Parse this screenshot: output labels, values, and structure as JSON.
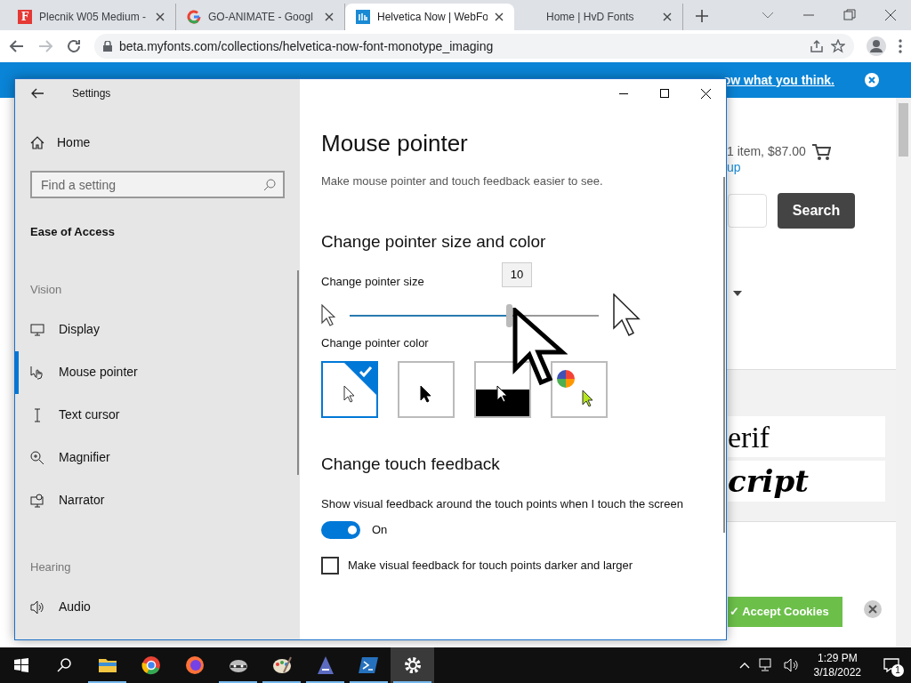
{
  "browser": {
    "tabs": [
      {
        "title": "Plecnik W05 Medium -",
        "kind": "letter",
        "favicon_text": "F",
        "selected": false
      },
      {
        "title": "GO-ANIMATE - Googl",
        "kind": "google",
        "selected": false
      },
      {
        "title": "Helvetica Now | WebFo",
        "kind": "myfonts",
        "selected": true
      },
      {
        "title": "Home | HvD Fonts",
        "kind": "blank",
        "selected": false
      }
    ],
    "address": "beta.myfonts.com/collections/helvetica-now-font-monotype_imaging",
    "banner_link": "ow what you think."
  },
  "webpage": {
    "cart": "1 item, $87.00",
    "link": "up",
    "search_button": "Search",
    "samples": [
      {
        "text": "erif",
        "kind": "serif"
      },
      {
        "text": "cript",
        "kind": "script"
      }
    ],
    "cookies_button": "✓ Accept Cookies"
  },
  "settings": {
    "title": "Settings",
    "home": "Home",
    "search_placeholder": "Find a setting",
    "category": "Ease of Access",
    "groups": [
      {
        "title": "Vision",
        "items": [
          {
            "label": "Display",
            "kind": "display",
            "selected": false
          },
          {
            "label": "Mouse pointer",
            "kind": "pointer",
            "selected": true
          },
          {
            "label": "Text cursor",
            "kind": "cursor",
            "selected": false
          },
          {
            "label": "Magnifier",
            "kind": "magnifier",
            "selected": false
          },
          {
            "label": "Narrator",
            "kind": "narrator",
            "selected": false
          }
        ]
      },
      {
        "title": "Hearing",
        "items": [
          {
            "label": "Audio",
            "kind": "audio",
            "selected": false
          }
        ]
      }
    ],
    "page_title": "Mouse pointer",
    "description": "Make mouse pointer and touch feedback easier to see.",
    "size_heading": "Change pointer size and color",
    "size_label": "Change pointer size",
    "size_value": "10",
    "level": 0.64,
    "color_label": "Change pointer color",
    "colors": [
      {
        "kind": "white",
        "selected": true
      },
      {
        "kind": "black",
        "selected": false
      },
      {
        "kind": "inverted",
        "selected": false
      },
      {
        "kind": "custom",
        "selected": false
      }
    ],
    "touch_heading": "Change touch feedback",
    "touch_label": "Show visual feedback around the touch points when I touch the screen",
    "touch_on": true,
    "touch_state": "On",
    "darker_label": "Make visual feedback for touch points darker and larger",
    "darker_checked": false
  },
  "taskbar": {
    "apps": [
      {
        "kind": "explorer",
        "running": true,
        "active": false
      },
      {
        "kind": "chrome",
        "running": false,
        "active": false
      },
      {
        "kind": "firefox",
        "running": false,
        "active": false
      },
      {
        "kind": "raccoon",
        "running": true,
        "active": false
      },
      {
        "kind": "paint",
        "running": true,
        "active": false
      },
      {
        "kind": "font",
        "running": true,
        "active": false
      },
      {
        "kind": "powershell",
        "running": true,
        "active": false
      },
      {
        "kind": "settings",
        "running": true,
        "active": true
      }
    ],
    "time": "1:29 PM",
    "date": "3/18/2022",
    "notifications": "1"
  }
}
